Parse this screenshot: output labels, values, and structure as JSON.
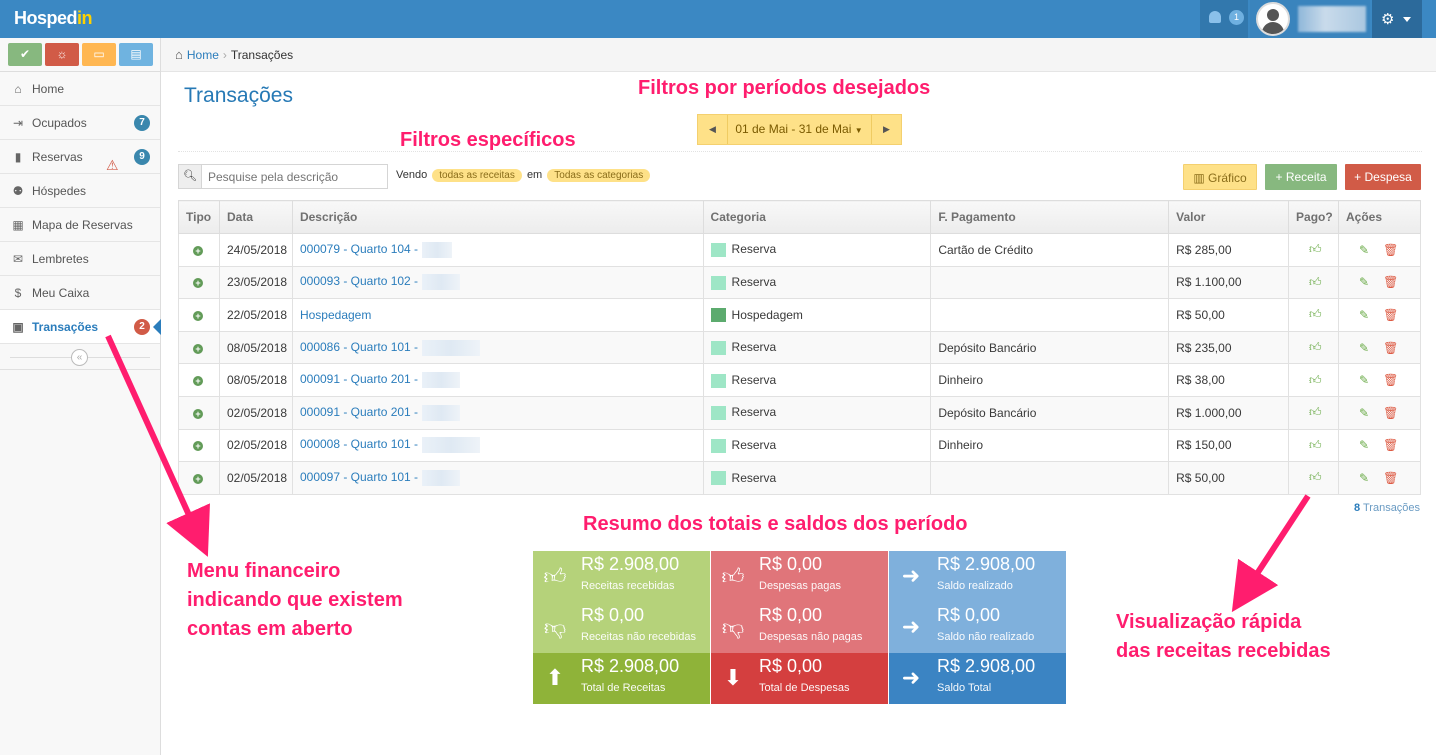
{
  "app": {
    "logo_main": "Hosped",
    "logo_accent": "in"
  },
  "topbar": {
    "notifications_count": "1"
  },
  "sidebar": {
    "shortcut_colors": [
      "#87b87f",
      "#d15b47",
      "#ffb752",
      "#6fb3e0"
    ],
    "items": [
      {
        "label": "Home",
        "icon": "home-icon",
        "glyph": "⌂"
      },
      {
        "label": "Ocupados",
        "icon": "sign-in-icon",
        "glyph": "⇥",
        "badge": "7",
        "badge_color": "#3a87ad"
      },
      {
        "label": "Reservas",
        "icon": "book-icon",
        "glyph": "▮",
        "badge": "9",
        "badge_color": "#3a87ad",
        "warning": true
      },
      {
        "label": "Hóspedes",
        "icon": "users-icon",
        "glyph": "⚉"
      },
      {
        "label": "Mapa de Reservas",
        "icon": "calendar-icon",
        "glyph": "▦"
      },
      {
        "label": "Lembretes",
        "icon": "envelope-icon",
        "glyph": "✉"
      },
      {
        "label": "Meu Caixa",
        "icon": "dollar-icon",
        "glyph": "$"
      },
      {
        "label": "Transações",
        "icon": "money-icon",
        "glyph": "▣",
        "badge": "2",
        "badge_color": "#d15b47",
        "active": true
      }
    ]
  },
  "breadcrumb": {
    "home": "Home",
    "current": "Transações"
  },
  "page": {
    "title": "Transações"
  },
  "date_filter": {
    "range": "01 de Mai - 31 de Mai"
  },
  "search": {
    "placeholder": "Pesquise pela descrição"
  },
  "filters": {
    "prefix": "Vendo",
    "type_pill": "todas as receitas",
    "middle": "em",
    "category_pill": "Todas as categorias"
  },
  "buttons": {
    "grafico": "Gráfico",
    "receita": "Receita",
    "despesa": "Despesa"
  },
  "table": {
    "headers": [
      "Tipo",
      "Data",
      "Descrição",
      "Categoria",
      "F. Pagamento",
      "Valor",
      "Pago?",
      "Ações"
    ],
    "rows": [
      {
        "date": "24/05/2018",
        "desc": "000079 - Quarto 104 -",
        "category": "Reserva",
        "cat_color": "#9ee6c6",
        "payment": "Cartão de Crédito",
        "value": "R$ 285,00"
      },
      {
        "date": "23/05/2018",
        "desc": "000093 - Quarto 102 -",
        "category": "Reserva",
        "cat_color": "#9ee6c6",
        "payment": "",
        "value": "R$ 1.100,00"
      },
      {
        "date": "22/05/2018",
        "desc": "Hospedagem",
        "category": "Hospedagem",
        "cat_color": "#5cab6e",
        "payment": "",
        "value": "R$ 50,00"
      },
      {
        "date": "08/05/2018",
        "desc": "000086 - Quarto 101 -",
        "category": "Reserva",
        "cat_color": "#9ee6c6",
        "payment": "Depósito Bancário",
        "value": "R$ 235,00"
      },
      {
        "date": "08/05/2018",
        "desc": "000091 - Quarto 201 -",
        "category": "Reserva",
        "cat_color": "#9ee6c6",
        "payment": "Dinheiro",
        "value": "R$ 38,00"
      },
      {
        "date": "02/05/2018",
        "desc": "000091 - Quarto 201 -",
        "category": "Reserva",
        "cat_color": "#9ee6c6",
        "payment": "Depósito Bancário",
        "value": "R$ 1.000,00"
      },
      {
        "date": "02/05/2018",
        "desc": "000008 - Quarto 101 -",
        "category": "Reserva",
        "cat_color": "#9ee6c6",
        "payment": "Dinheiro",
        "value": "R$ 150,00"
      },
      {
        "date": "02/05/2018",
        "desc": "000097 - Quarto 101 -",
        "category": "Reserva",
        "cat_color": "#9ee6c6",
        "payment": "",
        "value": "R$ 50,00"
      }
    ]
  },
  "count": {
    "number": "8",
    "label": "Transações"
  },
  "summary": [
    {
      "value": "R$ 2.908,00",
      "label": "Receitas recebidas",
      "icon": "thumbs-up-icon",
      "glyph": "👍︎",
      "color": "#b5d27a"
    },
    {
      "value": "R$ 0,00",
      "label": "Despesas pagas",
      "icon": "thumbs-up-icon",
      "glyph": "👍︎",
      "color": "#e0757a"
    },
    {
      "value": "R$ 2.908,00",
      "label": "Saldo realizado",
      "icon": "arrow-right-icon",
      "glyph": "➜",
      "color": "#7fb0dc"
    },
    {
      "value": "R$ 0,00",
      "label": "Receitas não recebidas",
      "icon": "thumbs-down-icon",
      "glyph": "👎︎",
      "color": "#b5d27a"
    },
    {
      "value": "R$ 0,00",
      "label": "Despesas não pagas",
      "icon": "thumbs-down-icon",
      "glyph": "👎︎",
      "color": "#e0757a"
    },
    {
      "value": "R$ 0,00",
      "label": "Saldo não realizado",
      "icon": "arrow-right-icon",
      "glyph": "➜",
      "color": "#7fb0dc"
    },
    {
      "value": "R$ 2.908,00",
      "label": "Total de Receitas",
      "icon": "arrow-up-icon",
      "glyph": "⬆",
      "color": "#8fb339"
    },
    {
      "value": "R$ 0,00",
      "label": "Total de Despesas",
      "icon": "arrow-down-icon",
      "glyph": "⬇",
      "color": "#d43f3f"
    },
    {
      "value": "R$ 2.908,00",
      "label": "Saldo Total",
      "icon": "arrow-right-icon",
      "glyph": "➜",
      "color": "#3b84c3"
    }
  ],
  "annotations": {
    "periods": "Filtros por períodos desejados",
    "specific": "Filtros específicos",
    "summary": "Resumo dos totais e saldos dos período",
    "menu_line1": "Menu financeiro",
    "menu_line2": "indicando que existem",
    "menu_line3": "contas em aberto",
    "quick_line1": "Visualização rápida",
    "quick_line2": "das receitas recebidas",
    "color": "#ff1d6e"
  }
}
